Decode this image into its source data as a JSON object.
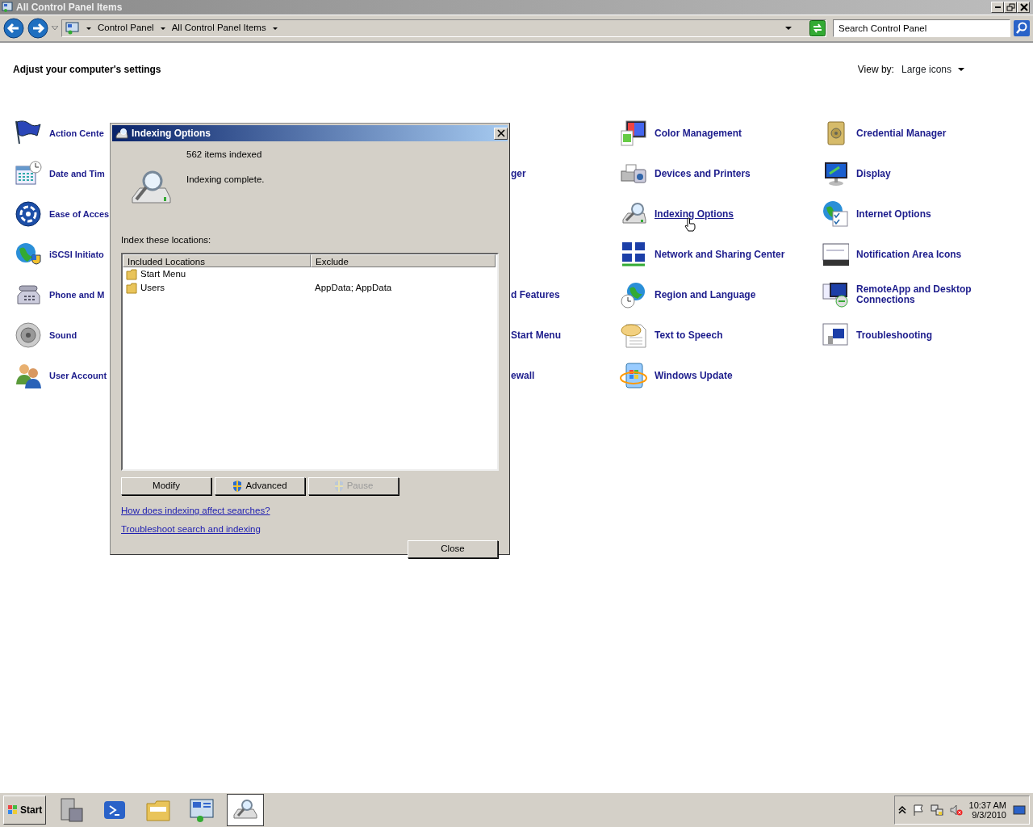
{
  "window": {
    "title": "All Control Panel Items"
  },
  "toolbar": {
    "breadcrumbs": [
      "Control Panel",
      "All Control Panel Items"
    ],
    "search": {
      "placeholder": "Search Control Panel"
    }
  },
  "heading": "Adjust your computer's settings",
  "view_by": {
    "label": "View by:",
    "value": "Large icons"
  },
  "item_rows": [
    {
      "column_1": {
        "label": "Action Cente",
        "hovered": false
      },
      "column_4": {
        "label": "Color Management",
        "hovered": false
      },
      "column_5": {
        "label": "Credential Manager",
        "hovered": false
      }
    },
    {
      "column_1": {
        "label": "Date and Tim",
        "hovered": false
      },
      "column_3": {
        "label": "ger",
        "hovered": false
      },
      "column_4": {
        "label": "Devices and Printers",
        "hovered": false
      },
      "column_5": {
        "label": "Display",
        "hovered": false
      }
    },
    {
      "column_1": {
        "label": "Ease of Acces",
        "hovered": false
      },
      "column_4": {
        "label": "Indexing Options",
        "hovered": true
      },
      "column_5": {
        "label": "Internet Options",
        "hovered": false
      }
    },
    {
      "column_1": {
        "label": "iSCSI Initiato",
        "hovered": false
      },
      "column_4": {
        "label": "Network and Sharing Center",
        "hovered": false
      },
      "column_5": {
        "label": "Notification Area Icons",
        "hovered": false
      }
    },
    {
      "column_1": {
        "label": "Phone and M",
        "hovered": false
      },
      "column_3": {
        "label": "d Features",
        "hovered": false
      },
      "column_4": {
        "label": "Region and Language",
        "hovered": false
      },
      "column_5": {
        "label": "RemoteApp and Desktop Connections",
        "hovered": false
      }
    },
    {
      "column_1": {
        "label": "Sound",
        "hovered": false
      },
      "column_3": {
        "label": "Start Menu",
        "hovered": false
      },
      "column_4": {
        "label": "Text to Speech",
        "hovered": false
      },
      "column_5": {
        "label": "Troubleshooting",
        "hovered": false
      }
    },
    {
      "column_1": {
        "label": "User Account",
        "hovered": false
      },
      "column_3": {
        "label": "ewall",
        "hovered": false
      },
      "column_4": {
        "label": "Windows Update",
        "hovered": false
      }
    }
  ],
  "dialog": {
    "title": "Indexing Options",
    "count": "562 items indexed",
    "status": "Indexing complete.",
    "locations_label": "Index these locations:",
    "table": {
      "columns": [
        "Included Locations",
        "Exclude"
      ],
      "rows": [
        [
          "Start Menu",
          ""
        ],
        [
          "Users",
          "AppData; AppData"
        ]
      ]
    },
    "buttons": [
      {
        "label": "Modify",
        "shield": false,
        "disabled": false
      },
      {
        "label": "Advanced",
        "shield": true,
        "disabled": false
      },
      {
        "label": "Pause",
        "shield": true,
        "disabled": true
      }
    ],
    "links": [
      "How does indexing affect searches?",
      "Troubleshoot search and indexing"
    ],
    "close_button": "Close"
  },
  "taskbar": {
    "start": "Start",
    "apps": [
      {
        "selected": false
      },
      {
        "selected": false
      },
      {
        "selected": false
      },
      {
        "selected": false
      },
      {
        "selected": true
      }
    ],
    "clock": {
      "time": "10:37 AM",
      "date": "9/3/2010"
    }
  }
}
